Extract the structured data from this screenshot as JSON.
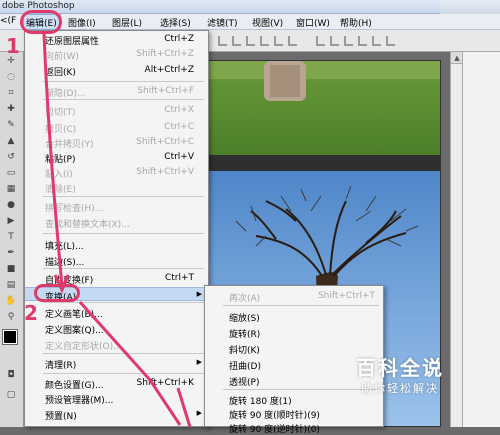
{
  "app_title": "dobe Photoshop",
  "menubar": [
    {
      "label": "<(F"
    },
    {
      "label": "编辑(E)"
    },
    {
      "label": "图像(I)"
    },
    {
      "label": "图层(L)"
    },
    {
      "label": "选择(S)"
    },
    {
      "label": "滤镜(T)"
    },
    {
      "label": "视图(V)"
    },
    {
      "label": "窗口(W)"
    },
    {
      "label": "帮助(H)"
    }
  ],
  "edit_menu": [
    {
      "label": "还原图层属性",
      "shortcut": "Ctrl+Z",
      "disabled": false
    },
    {
      "label": "向前(W)",
      "shortcut": "Shift+Ctrl+Z",
      "disabled": true
    },
    {
      "label": "返回(K)",
      "shortcut": "Alt+Ctrl+Z",
      "disabled": false
    },
    {
      "label": "渐隐(D)...",
      "shortcut": "Shift+Ctrl+F",
      "disabled": true
    },
    {
      "label": "剪切(T)",
      "shortcut": "Ctrl+X",
      "disabled": true
    },
    {
      "label": "拷贝(C)",
      "shortcut": "Ctrl+C",
      "disabled": true
    },
    {
      "label": "合并拷贝(Y)",
      "shortcut": "Shift+Ctrl+C",
      "disabled": true
    },
    {
      "label": "粘贴(P)",
      "shortcut": "Ctrl+V",
      "disabled": false
    },
    {
      "label": "贴入(I)",
      "shortcut": "Shift+Ctrl+V",
      "disabled": true
    },
    {
      "label": "清除(E)",
      "shortcut": "",
      "disabled": true
    },
    {
      "label": "拼写检查(H)...",
      "shortcut": "",
      "disabled": true
    },
    {
      "label": "查找和替换文本(X)...",
      "shortcut": "",
      "disabled": true
    },
    {
      "label": "填充(L)...",
      "shortcut": "",
      "disabled": false
    },
    {
      "label": "描边(S)...",
      "shortcut": "",
      "disabled": false
    },
    {
      "label": "自由变换(F)",
      "shortcut": "Ctrl+T",
      "disabled": false
    },
    {
      "label": "变换(A)",
      "shortcut": "",
      "disabled": false,
      "submenu": true,
      "highlighted": true
    },
    {
      "label": "定义画笔(B)...",
      "shortcut": "",
      "disabled": false
    },
    {
      "label": "定义图案(Q)...",
      "shortcut": "",
      "disabled": false
    },
    {
      "label": "定义自定形状(O)...",
      "shortcut": "",
      "disabled": true
    },
    {
      "label": "清理(R)",
      "shortcut": "",
      "disabled": false,
      "submenu": true
    },
    {
      "label": "颜色设置(G)...",
      "shortcut": "Shift+Ctrl+K",
      "disabled": false
    },
    {
      "label": "预设管理器(M)...",
      "shortcut": "",
      "disabled": false
    },
    {
      "label": "预置(N)",
      "shortcut": "",
      "disabled": false,
      "submenu": true
    }
  ],
  "transform_submenu": [
    {
      "label": "再次(A)",
      "shortcut": "Shift+Ctrl+T",
      "disabled": true
    },
    {
      "label": "缩放(S)",
      "shortcut": ""
    },
    {
      "label": "旋转(R)",
      "shortcut": ""
    },
    {
      "label": "斜切(K)",
      "shortcut": ""
    },
    {
      "label": "扭曲(D)",
      "shortcut": ""
    },
    {
      "label": "透视(P)",
      "shortcut": ""
    },
    {
      "label": "旋转 180 度(1)",
      "shortcut": ""
    },
    {
      "label": "旋转 90 度(顺时针)(9)",
      "shortcut": ""
    },
    {
      "label": "旋转 90 度(逆时针)(0)",
      "shortcut": ""
    }
  ],
  "annotations": {
    "step1": "1",
    "step2": "2"
  },
  "watermark": {
    "title": "百科全说",
    "subtitle": "助你轻松解决"
  },
  "colors": {
    "annotation": "#e03a6a",
    "menu_highlight": "#c6d9f2"
  }
}
